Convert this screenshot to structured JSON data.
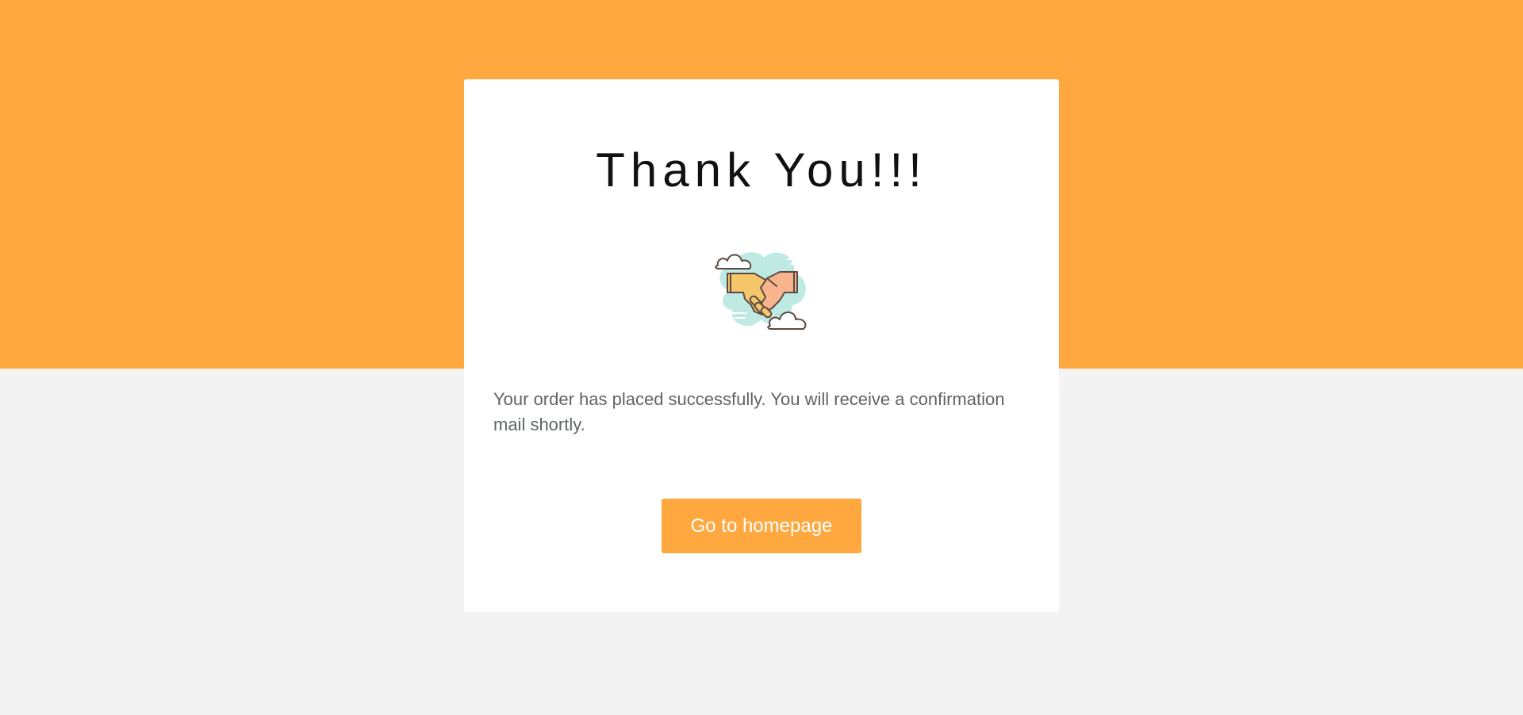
{
  "page": {
    "title": "Thank You!!!",
    "message": "Your order has placed successfully. You will receive a confirmation mail shortly.",
    "button_label": "Go to homepage",
    "illustration": "handshake-icon"
  },
  "colors": {
    "accent": "#ffa83f",
    "background": "#f3f3f3",
    "card": "#ffffff",
    "title": "#111111",
    "body_text": "#5f6368"
  }
}
